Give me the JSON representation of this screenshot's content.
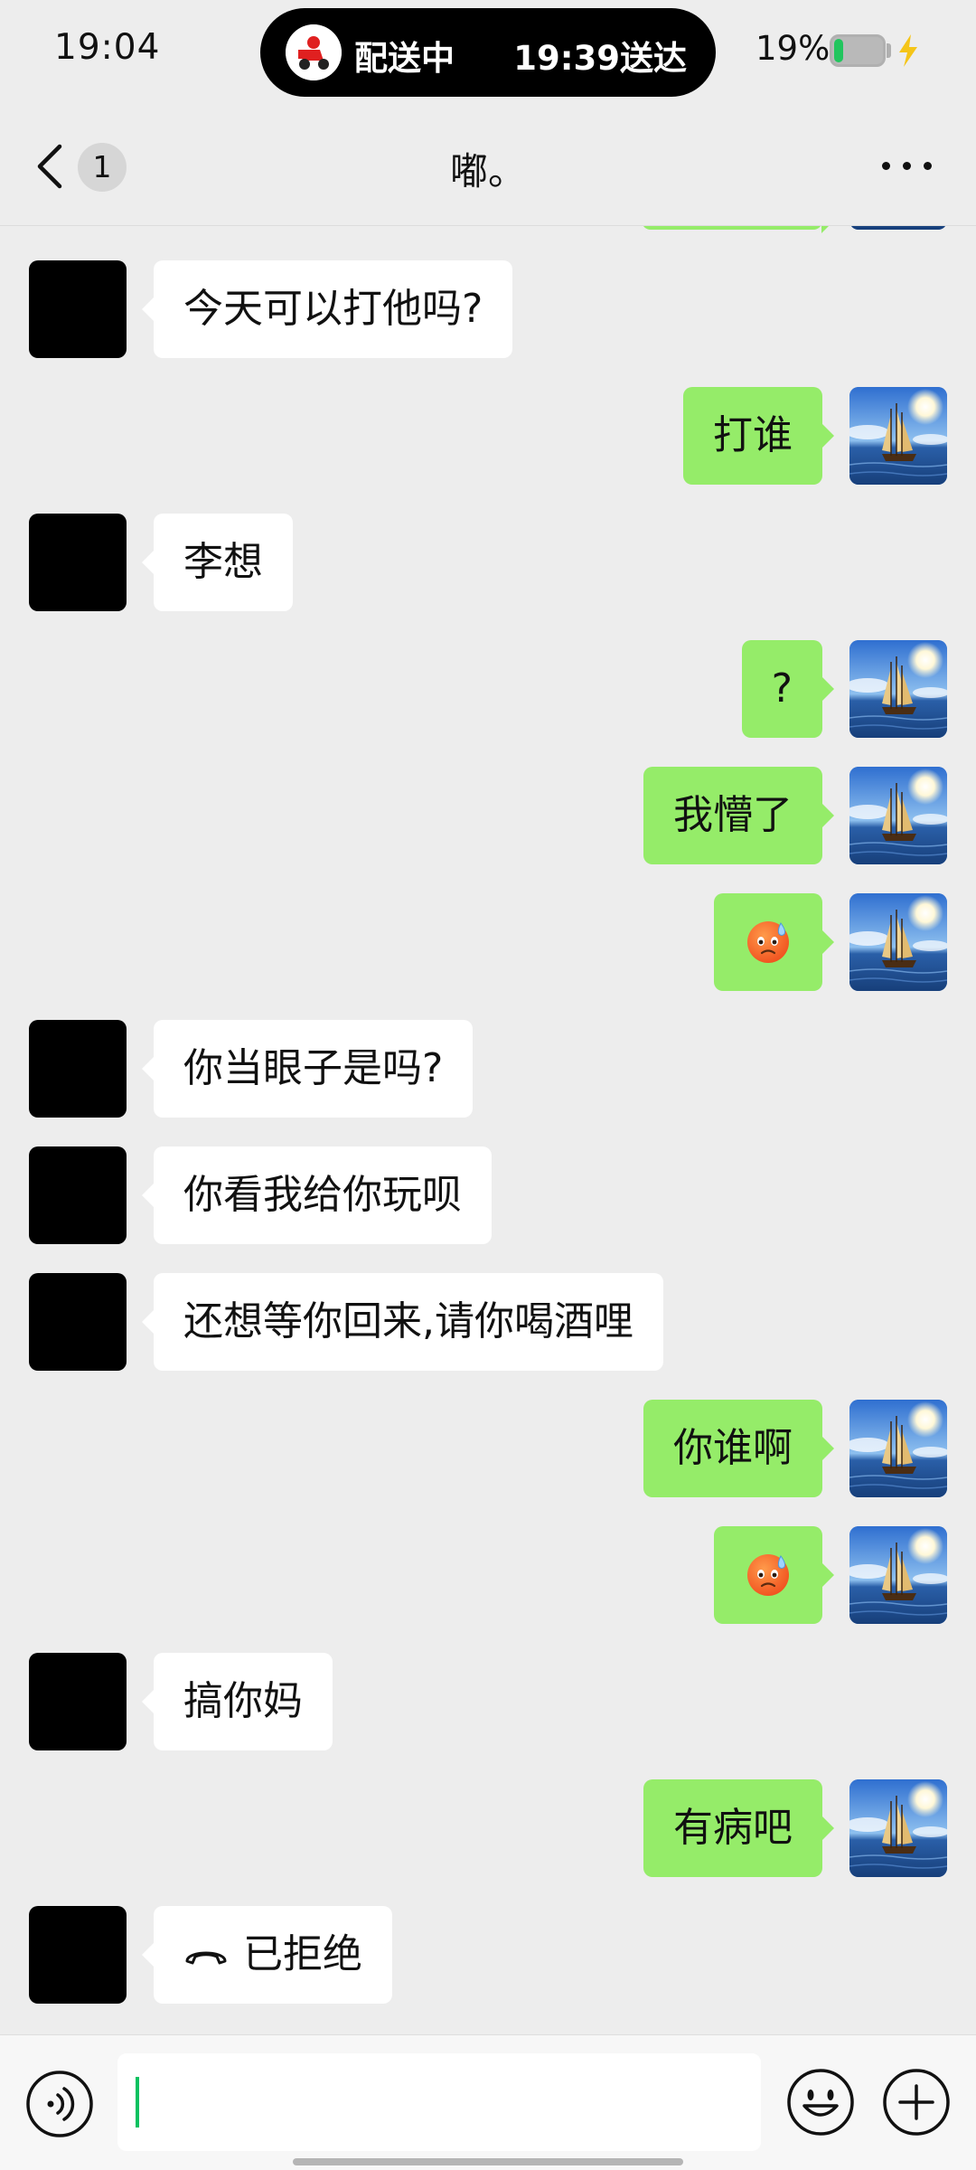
{
  "status_bar": {
    "time": "19:04",
    "delivery_status": "配送中",
    "delivery_eta": "19:39送达",
    "battery_percent": "19%",
    "battery_level": 0.19,
    "battery_fill_color": "#22c55e",
    "charging": true
  },
  "nav": {
    "unread_count": "1",
    "title": "嘟。",
    "back_icon": "chevron-left-icon",
    "more_icon": "more-dots-icon"
  },
  "messages": [
    {
      "side": "other",
      "type": "text",
      "text": "今天可以打他吗?"
    },
    {
      "side": "me",
      "type": "text",
      "text": "打谁"
    },
    {
      "side": "other",
      "type": "text",
      "text": "李想"
    },
    {
      "side": "me",
      "type": "text",
      "text": "?"
    },
    {
      "side": "me",
      "type": "text",
      "text": "我懵了"
    },
    {
      "side": "me",
      "type": "emoji",
      "emoji": "sweat-face-emoji"
    },
    {
      "side": "other",
      "type": "text",
      "text": "你当眼子是吗?"
    },
    {
      "side": "other",
      "type": "text",
      "text": "你看我给你玩呗"
    },
    {
      "side": "other",
      "type": "text",
      "text": "还想等你回来,请你喝酒哩"
    },
    {
      "side": "me",
      "type": "text",
      "text": "你谁啊"
    },
    {
      "side": "me",
      "type": "emoji",
      "emoji": "sweat-face-emoji"
    },
    {
      "side": "other",
      "type": "text",
      "text": "搞你妈"
    },
    {
      "side": "me",
      "type": "text",
      "text": "有病吧"
    },
    {
      "side": "other",
      "type": "call",
      "text": "已拒绝",
      "icon": "hangup-icon"
    }
  ],
  "input_bar": {
    "value": "",
    "voice_icon": "voice-icon",
    "emoji_icon": "emoji-icon",
    "plus_icon": "plus-icon"
  },
  "colors": {
    "background": "#ededed",
    "my_bubble": "#95ec69",
    "their_bubble": "#ffffff",
    "accent": "#07c160"
  }
}
